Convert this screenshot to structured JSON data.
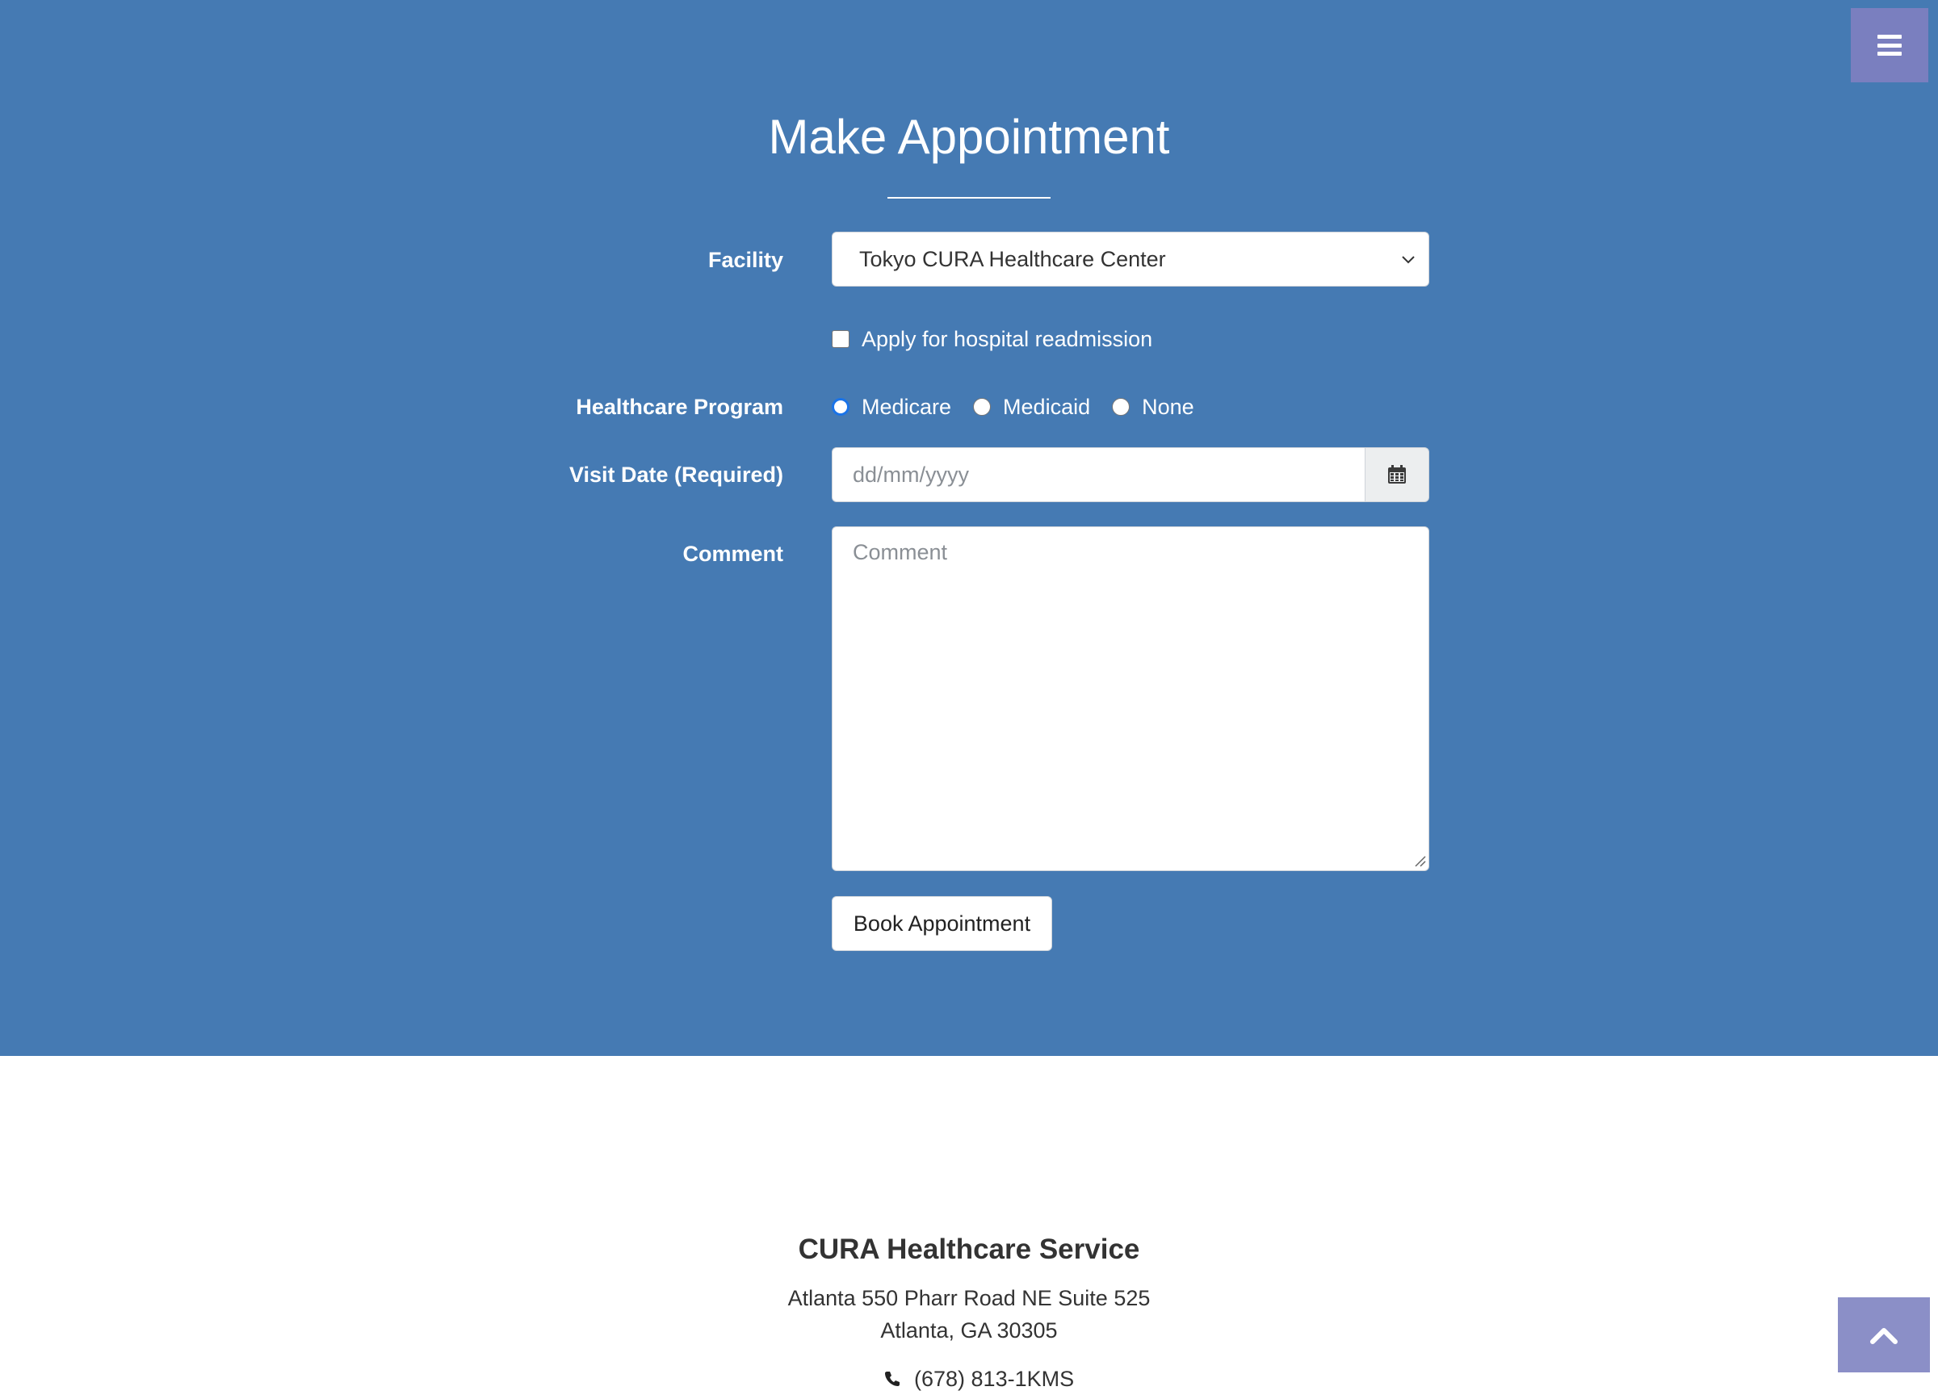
{
  "nav": {
    "menu_toggle_icon": "menu-bars-icon"
  },
  "appointment_form": {
    "title": "Make Appointment",
    "facility": {
      "label": "Facility",
      "selected_value": "Tokyo CURA Healthcare Center"
    },
    "readmission": {
      "label": "Apply for hospital readmission",
      "checked": false
    },
    "healthcare_program": {
      "label": "Healthcare Program",
      "options": [
        "Medicare",
        "Medicaid",
        "None"
      ],
      "selected": "Medicare"
    },
    "visit_date": {
      "label": "Visit Date (Required)",
      "placeholder": "dd/mm/yyyy",
      "value": "",
      "icon": "calendar-icon"
    },
    "comment": {
      "label": "Comment",
      "placeholder": "Comment",
      "value": ""
    },
    "submit_label": "Book Appointment"
  },
  "footer": {
    "company": "CURA Healthcare Service",
    "address_line1": "Atlanta 550 Pharr Road NE Suite 525",
    "address_line2": "Atlanta, GA 30305",
    "phone": "(678) 813-1KMS",
    "phone_icon": "phone-icon"
  },
  "scroll_top_icon": "chevron-up-icon",
  "colors": {
    "hero_background": "#457ab3",
    "menu_button": "#7a7fbf",
    "scroll_top_button": "#8b8fc7",
    "radio_selected": "#1a73e8"
  }
}
